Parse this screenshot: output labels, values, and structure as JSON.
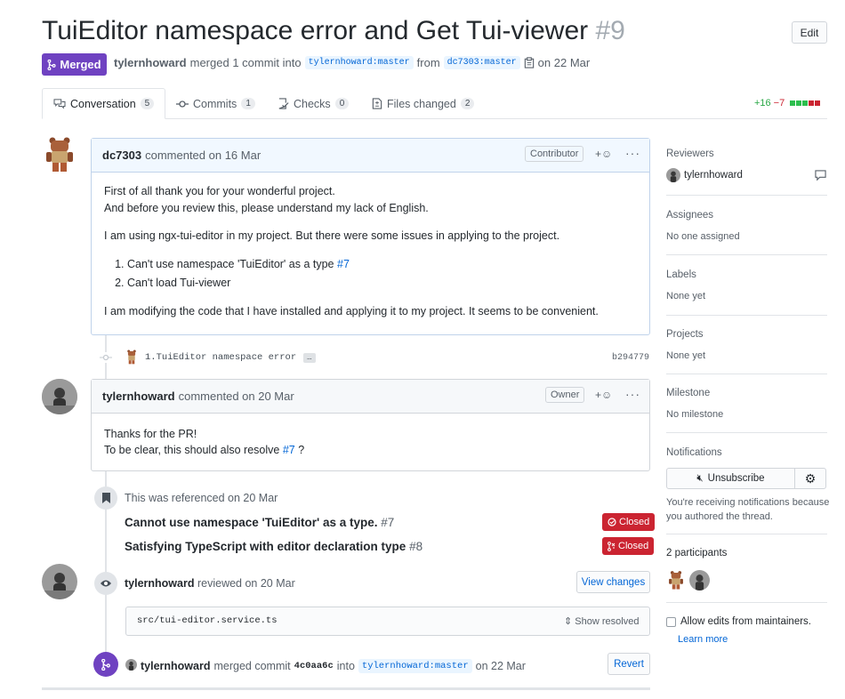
{
  "header": {
    "title": "TuiEditor namespace error and Get Tui-viewer",
    "number": "#9",
    "edit_label": "Edit",
    "state_label": "Merged",
    "author": "tylernhoward",
    "merged_text": "merged 1 commit into",
    "base_branch": "tylernhoward:master",
    "from_text": "from",
    "head_branch": "dc7303:master",
    "date_text": "on 22 Mar"
  },
  "tabs": [
    {
      "label": "Conversation",
      "count": "5",
      "icon": "comment-discussion-icon"
    },
    {
      "label": "Commits",
      "count": "1",
      "icon": "git-commit-icon"
    },
    {
      "label": "Checks",
      "count": "0",
      "icon": "checklist-icon"
    },
    {
      "label": "Files changed",
      "count": "2",
      "icon": "file-diff-icon"
    }
  ],
  "diffstat": {
    "additions": "+16",
    "deletions": "−7"
  },
  "colors": {
    "merged": "#6f42c1",
    "closed": "#cb2431",
    "link": "#0366d6",
    "add": "#28a745"
  },
  "comment1": {
    "author": "dc7303",
    "when": "commented on 16 Mar",
    "role": "Contributor",
    "para1_line1": "First of all thank you for your wonderful project.",
    "para1_line2": "And before you review this, please understand my lack of English.",
    "para2": "I am using ngx-tui-editor in my project. But there were some issues in applying to the project.",
    "item1_text": "Can't use namespace 'TuiEditor' as a type",
    "item1_ref": "#7",
    "item2_text": "Can't load Tui-viewer",
    "para3": "I am modifying the code that I have installed and applying it to my project. It seems to be convenient."
  },
  "commit": {
    "message": "1.TuiEditor namespace error",
    "ellipsis": "…",
    "sha": "b294779"
  },
  "comment2": {
    "author": "tylernhoward",
    "when": "commented on 20 Mar",
    "role": "Owner",
    "line1": "Thanks for the PR!",
    "line2_text": "To be clear, this should also resolve",
    "line2_ref": "#7",
    "line2_end": "?"
  },
  "reference": {
    "text": "This was referenced on 20 Mar",
    "items": [
      {
        "title": "Cannot use namespace 'TuiEditor' as a type.",
        "num": "#7",
        "state": "Closed"
      },
      {
        "title": "Satisfying TypeScript with editor declaration type",
        "num": "#8",
        "state": "Closed"
      }
    ]
  },
  "review": {
    "author": "tylernhoward",
    "when": "reviewed on 20 Mar",
    "view_changes": "View changes",
    "file": "src/tui-editor.service.ts",
    "show_resolved": "Show resolved"
  },
  "merge_event": {
    "author": "tylernhoward",
    "text": "merged commit",
    "sha": "4c0aa6c",
    "into": "into",
    "branch": "tylernhoward:master",
    "date": "on 22 Mar",
    "revert": "Revert"
  },
  "sidebar": {
    "reviewers_title": "Reviewers",
    "reviewer": "tylernhoward",
    "assignees_title": "Assignees",
    "assignees_value": "No one assigned",
    "labels_title": "Labels",
    "labels_value": "None yet",
    "projects_title": "Projects",
    "projects_value": "None yet",
    "milestone_title": "Milestone",
    "milestone_value": "No milestone",
    "notifications_title": "Notifications",
    "unsubscribe": "Unsubscribe",
    "notif_reason_1": "You're receiving notifications because",
    "notif_reason_2": "you authored the thread.",
    "participants_title": "2 participants",
    "allow_edits": "Allow edits from maintainers.",
    "learn_more": "Learn more"
  }
}
